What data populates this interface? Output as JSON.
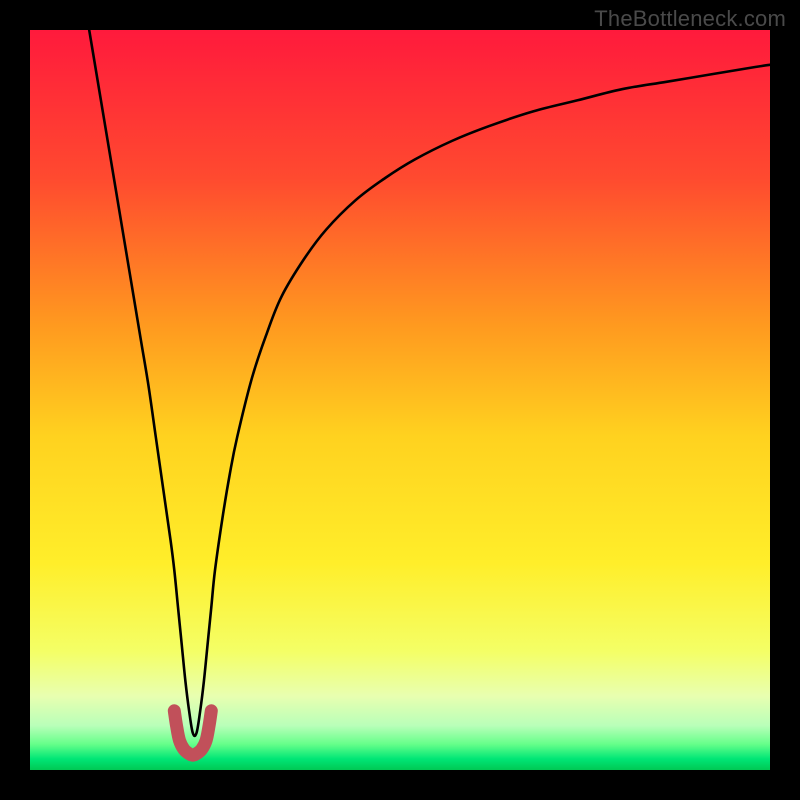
{
  "watermark": "TheBottleneck.com",
  "chart_data": {
    "type": "line",
    "title": "",
    "xlabel": "",
    "ylabel": "",
    "xlim": [
      0,
      100
    ],
    "ylim": [
      0,
      100
    ],
    "notch_x": 22,
    "background_gradient": {
      "stops": [
        {
          "offset": 0.0,
          "color": "#ff1a3c"
        },
        {
          "offset": 0.2,
          "color": "#ff4a2f"
        },
        {
          "offset": 0.4,
          "color": "#ff9a1f"
        },
        {
          "offset": 0.55,
          "color": "#ffd21f"
        },
        {
          "offset": 0.72,
          "color": "#ffee2a"
        },
        {
          "offset": 0.84,
          "color": "#f4ff66"
        },
        {
          "offset": 0.9,
          "color": "#e8ffb0"
        },
        {
          "offset": 0.94,
          "color": "#b9ffb9"
        },
        {
          "offset": 0.965,
          "color": "#66ff8a"
        },
        {
          "offset": 0.985,
          "color": "#00e676"
        },
        {
          "offset": 1.0,
          "color": "#00c853"
        }
      ]
    },
    "series": [
      {
        "name": "curve-main",
        "x": [
          8,
          9,
          10,
          11,
          12,
          13,
          14,
          15,
          16,
          17,
          18,
          19,
          19.5,
          20,
          20.5,
          21,
          21.5,
          22,
          22.5,
          23,
          23.5,
          24,
          24.5,
          25,
          26,
          27,
          28,
          30,
          32,
          34,
          37,
          40,
          44,
          48,
          52,
          57,
          62,
          68,
          74,
          80,
          86,
          92,
          98,
          100
        ],
        "y": [
          100,
          94,
          88,
          82,
          76,
          70,
          64,
          58,
          52,
          45,
          38,
          31,
          27,
          22,
          17,
          12,
          8,
          5,
          5,
          8,
          12,
          17,
          22,
          27,
          34,
          40,
          45,
          53,
          59,
          64,
          69,
          73,
          77,
          80,
          82.5,
          85,
          87,
          89,
          90.5,
          92,
          93,
          94,
          95,
          95.3
        ]
      },
      {
        "name": "u-marker",
        "x": [
          19.5,
          19.8,
          20.2,
          20.8,
          21.5,
          22.0,
          22.5,
          23.2,
          23.8,
          24.2,
          24.5
        ],
        "y": [
          8,
          6,
          4,
          2.8,
          2.2,
          2.0,
          2.2,
          2.8,
          4,
          6,
          8
        ]
      }
    ],
    "colors": {
      "curve_stroke": "#000000",
      "marker_stroke": "#c1505a"
    }
  }
}
